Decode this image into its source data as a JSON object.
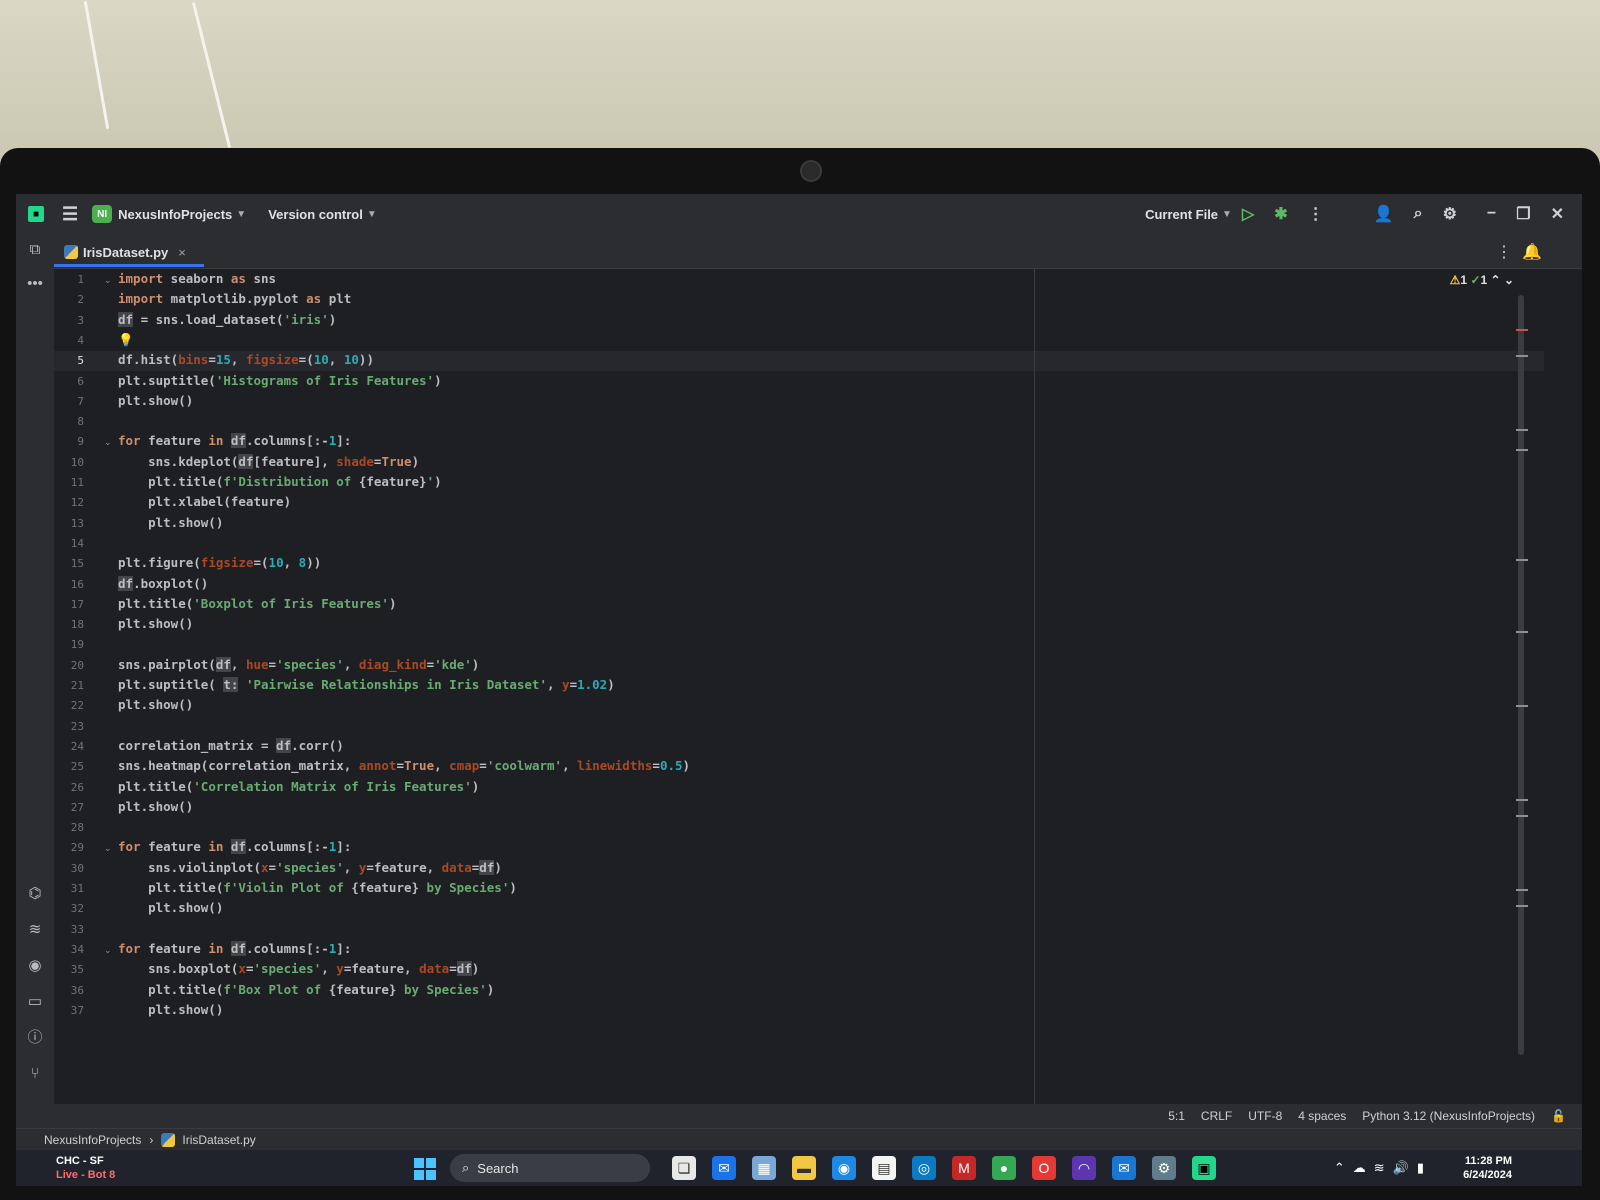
{
  "topbar": {
    "project_badge": "NI",
    "project_name": "NexusInfoProjects",
    "version_control": "Version control",
    "run_config": "Current File"
  },
  "tabs": [
    {
      "label": "IrisDataset.py"
    }
  ],
  "inspections": {
    "warnings": "1",
    "checks": "1"
  },
  "editor": {
    "current_line": 5,
    "lines": [
      {
        "n": "1",
        "fold": true
      },
      {
        "n": "2"
      },
      {
        "n": "3"
      },
      {
        "n": "4"
      },
      {
        "n": "5"
      },
      {
        "n": "6"
      },
      {
        "n": "7"
      },
      {
        "n": "8"
      },
      {
        "n": "9",
        "fold": true
      },
      {
        "n": "10"
      },
      {
        "n": "11"
      },
      {
        "n": "12"
      },
      {
        "n": "13"
      },
      {
        "n": "14"
      },
      {
        "n": "15"
      },
      {
        "n": "16"
      },
      {
        "n": "17"
      },
      {
        "n": "18"
      },
      {
        "n": "19"
      },
      {
        "n": "20"
      },
      {
        "n": "21"
      },
      {
        "n": "22"
      },
      {
        "n": "23"
      },
      {
        "n": "24"
      },
      {
        "n": "25"
      },
      {
        "n": "26"
      },
      {
        "n": "27"
      },
      {
        "n": "28"
      },
      {
        "n": "29",
        "fold": true
      },
      {
        "n": "30"
      },
      {
        "n": "31"
      },
      {
        "n": "32"
      },
      {
        "n": "33"
      },
      {
        "n": "34",
        "fold": true
      },
      {
        "n": "35"
      },
      {
        "n": "36"
      },
      {
        "n": "37"
      }
    ],
    "code": [
      [
        [
          "kw",
          "import"
        ],
        [
          "t",
          " seaborn "
        ],
        [
          "kw",
          "as"
        ],
        [
          "t",
          " sns"
        ]
      ],
      [
        [
          "kw",
          "import"
        ],
        [
          "t",
          " matplotlib.pyplot "
        ],
        [
          "kw",
          "as"
        ],
        [
          "t",
          " plt"
        ]
      ],
      [
        [
          "dfhl",
          "df"
        ],
        [
          "t",
          " = sns.load_dataset("
        ],
        [
          "str",
          "'iris'"
        ],
        [
          "t",
          ")"
        ]
      ],
      [
        [
          "bulb",
          "💡"
        ]
      ],
      [
        [
          "t",
          "df.hist("
        ],
        [
          "param",
          "bins"
        ],
        [
          "t",
          "="
        ],
        [
          "num",
          "15"
        ],
        [
          "t",
          ", "
        ],
        [
          "param",
          "figsize"
        ],
        [
          "t",
          "=("
        ],
        [
          "num",
          "10"
        ],
        [
          "t",
          ", "
        ],
        [
          "num",
          "10"
        ],
        [
          "t",
          "))"
        ]
      ],
      [
        [
          "t",
          "plt.suptitle("
        ],
        [
          "str",
          "'Histograms of Iris Features'"
        ],
        [
          "t",
          ")"
        ]
      ],
      [
        [
          "t",
          "plt.show()"
        ]
      ],
      [
        [
          "t",
          ""
        ]
      ],
      [
        [
          "kw",
          "for"
        ],
        [
          "t",
          " feature "
        ],
        [
          "kw",
          "in"
        ],
        [
          "t",
          " "
        ],
        [
          "dfhl",
          "df"
        ],
        [
          "t",
          ".columns[:-"
        ],
        [
          "num",
          "1"
        ],
        [
          "t",
          "]:"
        ]
      ],
      [
        [
          "t",
          "    sns.kdeplot("
        ],
        [
          "dfhl",
          "df"
        ],
        [
          "t",
          "[feature], "
        ],
        [
          "param",
          "shade"
        ],
        [
          "t",
          "="
        ],
        [
          "kw",
          "True"
        ],
        [
          "t",
          ")"
        ]
      ],
      [
        [
          "t",
          "    plt.title("
        ],
        [
          "str",
          "f'Distribution of "
        ],
        [
          "t",
          "{feature}"
        ],
        [
          "str",
          "'"
        ],
        [
          "t",
          ")"
        ]
      ],
      [
        [
          "t",
          "    plt.xlabel(feature)"
        ]
      ],
      [
        [
          "t",
          "    plt.show()"
        ]
      ],
      [
        [
          "t",
          ""
        ]
      ],
      [
        [
          "t",
          "plt.figure("
        ],
        [
          "param",
          "figsize"
        ],
        [
          "t",
          "=("
        ],
        [
          "num",
          "10"
        ],
        [
          "t",
          ", "
        ],
        [
          "num",
          "8"
        ],
        [
          "t",
          "))"
        ]
      ],
      [
        [
          "dfhl",
          "df"
        ],
        [
          "t",
          ".boxplot()"
        ]
      ],
      [
        [
          "t",
          "plt.title("
        ],
        [
          "str",
          "'Boxplot of Iris Features'"
        ],
        [
          "t",
          ")"
        ]
      ],
      [
        [
          "t",
          "plt.show()"
        ]
      ],
      [
        [
          "t",
          ""
        ]
      ],
      [
        [
          "t",
          "sns.pairplot("
        ],
        [
          "dfhl",
          "df"
        ],
        [
          "t",
          ", "
        ],
        [
          "param",
          "hue"
        ],
        [
          "t",
          "="
        ],
        [
          "str",
          "'species'"
        ],
        [
          "t",
          ", "
        ],
        [
          "param",
          "diag_kind"
        ],
        [
          "t",
          "="
        ],
        [
          "str",
          "'kde'"
        ],
        [
          "t",
          ")"
        ]
      ],
      [
        [
          "t",
          "plt.suptitle( "
        ],
        [
          "dfhl",
          "t:"
        ],
        [
          "t",
          " "
        ],
        [
          "str",
          "'Pairwise Relationships in Iris Dataset'"
        ],
        [
          "t",
          ", "
        ],
        [
          "param",
          "y"
        ],
        [
          "t",
          "="
        ],
        [
          "num",
          "1.02"
        ],
        [
          "t",
          ")"
        ]
      ],
      [
        [
          "t",
          "plt.show()"
        ]
      ],
      [
        [
          "t",
          ""
        ]
      ],
      [
        [
          "t",
          "correlation_matrix = "
        ],
        [
          "dfhl",
          "df"
        ],
        [
          "t",
          ".corr()"
        ]
      ],
      [
        [
          "t",
          "sns.heatmap(correlation_matrix, "
        ],
        [
          "param",
          "annot"
        ],
        [
          "t",
          "="
        ],
        [
          "kw",
          "True"
        ],
        [
          "t",
          ", "
        ],
        [
          "param",
          "cmap"
        ],
        [
          "t",
          "="
        ],
        [
          "str",
          "'coolwarm'"
        ],
        [
          "t",
          ", "
        ],
        [
          "param",
          "linewidths"
        ],
        [
          "t",
          "="
        ],
        [
          "num",
          "0.5"
        ],
        [
          "t",
          ")"
        ]
      ],
      [
        [
          "t",
          "plt.title("
        ],
        [
          "str",
          "'Correlation Matrix of Iris Features'"
        ],
        [
          "t",
          ")"
        ]
      ],
      [
        [
          "t",
          "plt.show()"
        ]
      ],
      [
        [
          "t",
          ""
        ]
      ],
      [
        [
          "kw",
          "for"
        ],
        [
          "t",
          " feature "
        ],
        [
          "kw",
          "in"
        ],
        [
          "t",
          " "
        ],
        [
          "dfhl",
          "df"
        ],
        [
          "t",
          ".columns[:-"
        ],
        [
          "num",
          "1"
        ],
        [
          "t",
          "]:"
        ]
      ],
      [
        [
          "t",
          "    sns.violinplot("
        ],
        [
          "param",
          "x"
        ],
        [
          "t",
          "="
        ],
        [
          "str",
          "'species'"
        ],
        [
          "t",
          ", "
        ],
        [
          "param",
          "y"
        ],
        [
          "t",
          "=feature, "
        ],
        [
          "param",
          "data"
        ],
        [
          "t",
          "="
        ],
        [
          "dfhl",
          "df"
        ],
        [
          "t",
          ")"
        ]
      ],
      [
        [
          "t",
          "    plt.title("
        ],
        [
          "str",
          "f'Violin Plot of "
        ],
        [
          "t",
          "{feature}"
        ],
        [
          "str",
          " by Species'"
        ],
        [
          "t",
          ")"
        ]
      ],
      [
        [
          "t",
          "    plt.show()"
        ]
      ],
      [
        [
          "t",
          ""
        ]
      ],
      [
        [
          "kw",
          "for"
        ],
        [
          "t",
          " feature "
        ],
        [
          "kw",
          "in"
        ],
        [
          "t",
          " "
        ],
        [
          "dfhl",
          "df"
        ],
        [
          "t",
          ".columns[:-"
        ],
        [
          "num",
          "1"
        ],
        [
          "t",
          "]:"
        ]
      ],
      [
        [
          "t",
          "    sns.boxplot("
        ],
        [
          "param",
          "x"
        ],
        [
          "t",
          "="
        ],
        [
          "str",
          "'species'"
        ],
        [
          "t",
          ", "
        ],
        [
          "param",
          "y"
        ],
        [
          "t",
          "=feature, "
        ],
        [
          "param",
          "data"
        ],
        [
          "t",
          "="
        ],
        [
          "dfhl",
          "df"
        ],
        [
          "t",
          ")"
        ]
      ],
      [
        [
          "t",
          "    plt.title("
        ],
        [
          "str",
          "f'Box Plot of "
        ],
        [
          "t",
          "{feature}"
        ],
        [
          "str",
          " by Species'"
        ],
        [
          "t",
          ")"
        ]
      ],
      [
        [
          "t",
          "    plt.show()"
        ]
      ]
    ]
  },
  "statusbar": {
    "position": "5:1",
    "line_sep": "CRLF",
    "encoding": "UTF-8",
    "indent": "4 spaces",
    "interpreter": "Python 3.12 (NexusInfoProjects)"
  },
  "breadcrumb": {
    "project": "NexusInfoProjects",
    "file": "IrisDataset.py"
  },
  "taskbar": {
    "weather_title": "CHC - SF",
    "weather_sub": "Live - Bot 8",
    "search_placeholder": "Search",
    "time": "11:28 PM",
    "date": "6/24/2024"
  }
}
